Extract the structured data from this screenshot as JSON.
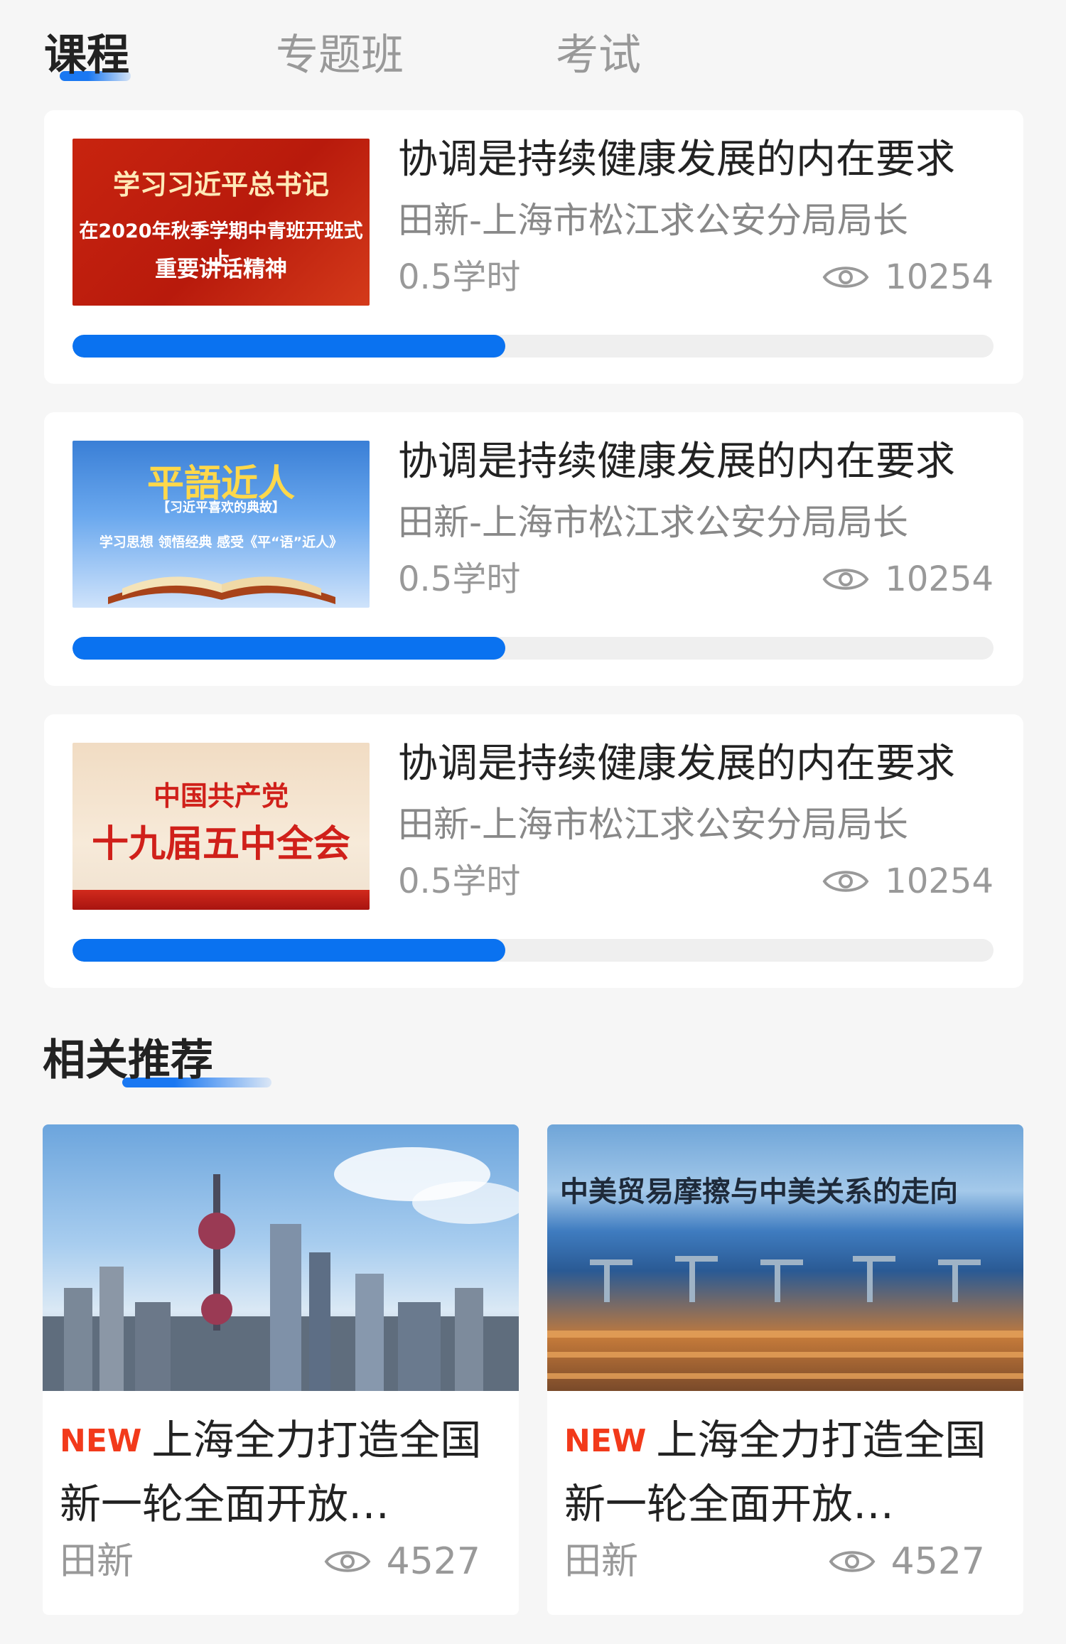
{
  "tabs": [
    {
      "label": "课程",
      "active": true
    },
    {
      "label": "专题班",
      "active": false
    },
    {
      "label": "考试",
      "active": false
    }
  ],
  "courses": [
    {
      "thumb_lines": [
        "学习习近平总书记",
        "在2020年秋季学期中青班开班式上",
        "重要讲话精神"
      ],
      "title": "协调是持续健康发展的内在要求",
      "author": "田新-上海市松江求公安分局局长",
      "hours": "0.5学时",
      "views": "10254",
      "progress": 0.47
    },
    {
      "thumb_lines": [
        "平語近人",
        "【习近平喜欢的典故】",
        "学习思想  领悟经典  感受《平“语”近人》"
      ],
      "title": "协调是持续健康发展的内在要求",
      "author": "田新-上海市松江求公安分局局长",
      "hours": "0.5学时",
      "views": "10254",
      "progress": 0.47
    },
    {
      "thumb_lines": [
        "中国共产党",
        "十九届五中全会"
      ],
      "title": "协调是持续健康发展的内在要求",
      "author": "田新-上海市松江求公安分局局长",
      "hours": "0.5学时",
      "views": "10254",
      "progress": 0.47
    }
  ],
  "recommend": {
    "title": "相关推荐",
    "items": [
      {
        "badge": "NEW",
        "title": "上海全力打造全国新一轮全面开放…",
        "author": "田新",
        "views": "4527"
      },
      {
        "badge": "NEW",
        "title": "上海全力打造全国新一轮全面开放…",
        "author": "田新",
        "views": "4527",
        "image_caption": "中美贸易摩擦与中美关系的走向"
      }
    ]
  },
  "colors": {
    "accent": "#0a72f0",
    "new_badge": "#f23a1b",
    "background": "#f6f6f6"
  }
}
